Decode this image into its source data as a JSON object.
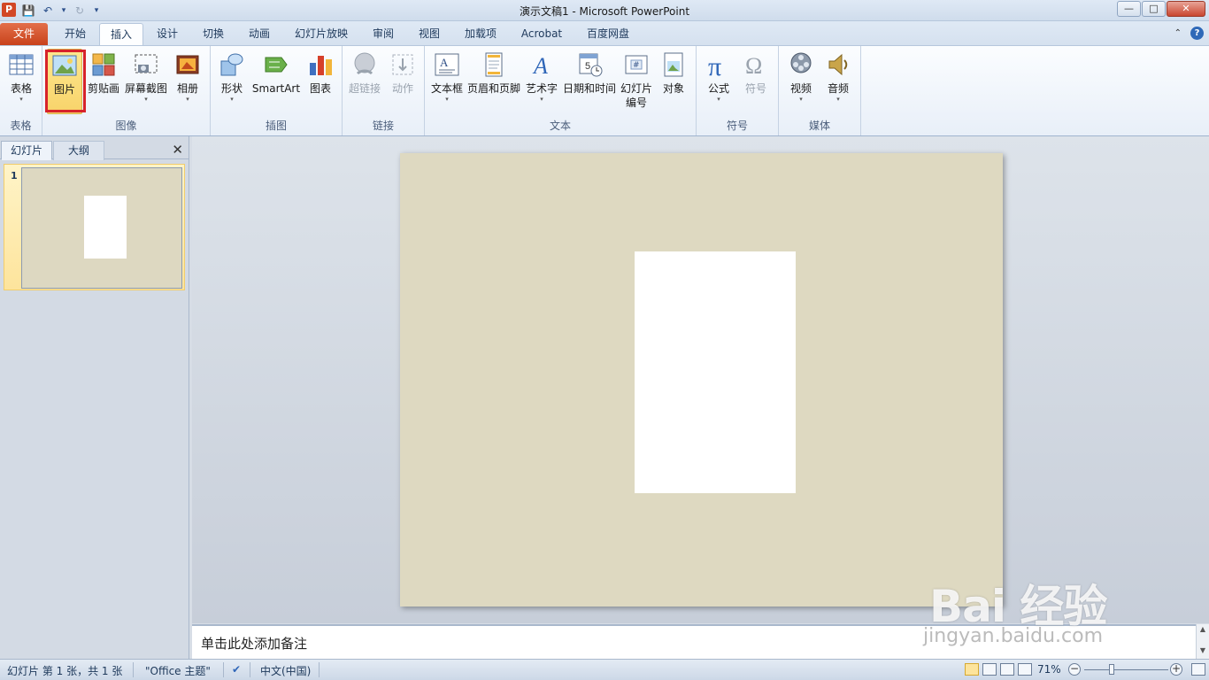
{
  "window": {
    "title": "演示文稿1 - Microsoft PowerPoint",
    "app_icon_letter": "P",
    "controls": {
      "minimize": "—",
      "maximize": "□",
      "close": "✕"
    }
  },
  "quick_access": {
    "save": "💾",
    "undo": "↶",
    "undo_arrow": "▾",
    "redo": "↻",
    "customize": "▾"
  },
  "tabs": [
    {
      "label": "文件"
    },
    {
      "label": "开始"
    },
    {
      "label": "插入"
    },
    {
      "label": "设计"
    },
    {
      "label": "切换"
    },
    {
      "label": "动画"
    },
    {
      "label": "幻灯片放映"
    },
    {
      "label": "审阅"
    },
    {
      "label": "视图"
    },
    {
      "label": "加载项"
    },
    {
      "label": "Acrobat"
    },
    {
      "label": "百度网盘"
    }
  ],
  "ribbon": {
    "groups": {
      "tables": "表格",
      "images": "图像",
      "illustrations": "插图",
      "links": "链接",
      "text": "文本",
      "symbols": "符号",
      "media": "媒体"
    },
    "buttons": {
      "table": "表格",
      "picture": "图片",
      "clipart": "剪贴画",
      "screenshot": "屏幕截图",
      "album": "相册",
      "shapes": "形状",
      "smartart": "SmartArt",
      "chart": "图表",
      "hyperlink": "超链接",
      "action": "动作",
      "textbox": "文本框",
      "header_footer": "页眉和页脚",
      "wordart": "艺术字",
      "datetime": "日期和时间",
      "slide_number_1": "幻灯片",
      "slide_number_2": "编号",
      "object": "对象",
      "equation": "公式",
      "symbol": "符号",
      "video": "视频",
      "audio": "音频"
    }
  },
  "left_panel": {
    "tab_slides": "幻灯片",
    "tab_outline": "大纲",
    "close": "✕",
    "slide_number": "1"
  },
  "notes": {
    "placeholder": "单击此处添加备注"
  },
  "status": {
    "slide_info": "幻灯片 第 1 张，共 1 张",
    "theme": "\"Office 主题\"",
    "language": "中文(中国)",
    "zoom": "71%"
  },
  "watermark": {
    "brand": "Bai 经验",
    "url": "jingyan.baidu.com"
  }
}
